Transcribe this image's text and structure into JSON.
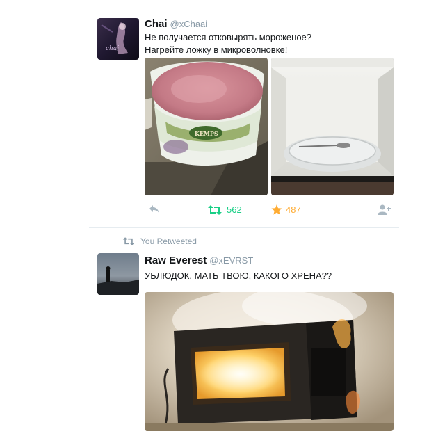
{
  "tweet1": {
    "name": "Chai",
    "handle": "@xChaai",
    "text": "Не получается отковырять мороженое?\nНагрейте ложку в микроволновке!",
    "ice_cream_brand": "KEMPS",
    "retweet_count": "562",
    "like_count": "487",
    "avatar_signature": "chaj"
  },
  "retweet_banner": {
    "label": "You Retweeted"
  },
  "tweet2": {
    "name": "Raw Everest",
    "handle": "@xEVRST",
    "text": "УБЛЮДОК, МАТЬ ТВОЮ, КАКОГО ХРЕНА??"
  },
  "colors": {
    "retweet_green": "#19cf86",
    "like_gold": "#ffac33",
    "muted_gray": "#aab8c2",
    "handle_gray": "#8899a6"
  }
}
